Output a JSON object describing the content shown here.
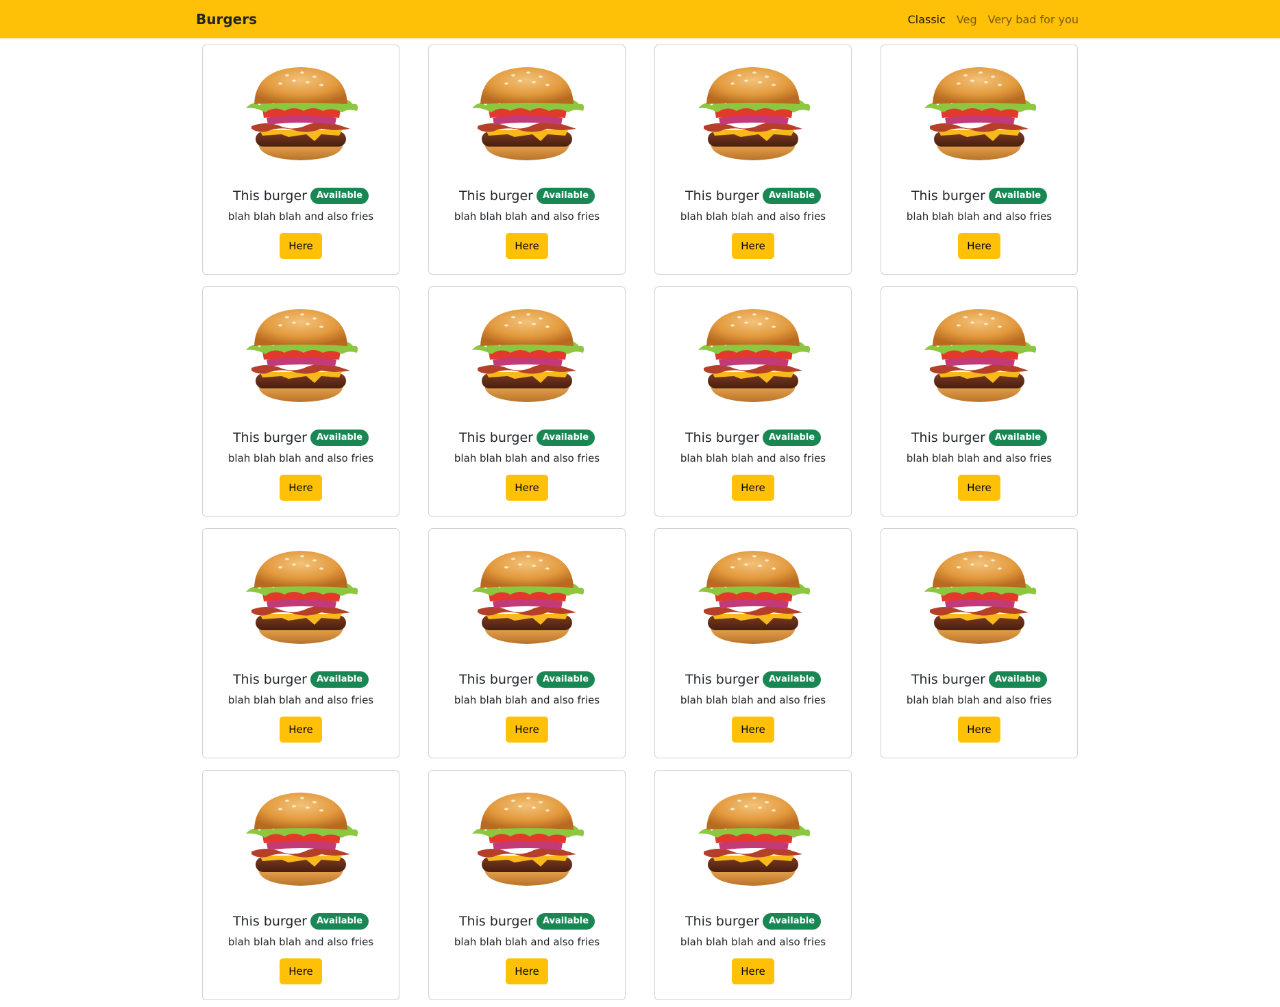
{
  "navbar": {
    "brand": "Burgers",
    "links": [
      {
        "label": "Classic",
        "active": true
      },
      {
        "label": "Veg",
        "active": false
      },
      {
        "label": "Very bad for you",
        "active": false
      }
    ]
  },
  "colors": {
    "navbar_bg": "#ffc107",
    "badge_bg": "#198754",
    "button_bg": "#ffc107"
  },
  "cards": [
    {
      "title": "This burger",
      "badge": "Available",
      "text": "blah blah blah and also fries",
      "button": "Here",
      "image": "burger-image"
    },
    {
      "title": "This burger",
      "badge": "Available",
      "text": "blah blah blah and also fries",
      "button": "Here",
      "image": "burger-image"
    },
    {
      "title": "This burger",
      "badge": "Available",
      "text": "blah blah blah and also fries",
      "button": "Here",
      "image": "burger-image"
    },
    {
      "title": "This burger",
      "badge": "Available",
      "text": "blah blah blah and also fries",
      "button": "Here",
      "image": "burger-image"
    },
    {
      "title": "This burger",
      "badge": "Available",
      "text": "blah blah blah and also fries",
      "button": "Here",
      "image": "burger-image"
    },
    {
      "title": "This burger",
      "badge": "Available",
      "text": "blah blah blah and also fries",
      "button": "Here",
      "image": "burger-image"
    },
    {
      "title": "This burger",
      "badge": "Available",
      "text": "blah blah blah and also fries",
      "button": "Here",
      "image": "burger-image"
    },
    {
      "title": "This burger",
      "badge": "Available",
      "text": "blah blah blah and also fries",
      "button": "Here",
      "image": "burger-image"
    },
    {
      "title": "This burger",
      "badge": "Available",
      "text": "blah blah blah and also fries",
      "button": "Here",
      "image": "burger-image"
    },
    {
      "title": "This burger",
      "badge": "Available",
      "text": "blah blah blah and also fries",
      "button": "Here",
      "image": "burger-image"
    },
    {
      "title": "This burger",
      "badge": "Available",
      "text": "blah blah blah and also fries",
      "button": "Here",
      "image": "burger-image"
    },
    {
      "title": "This burger",
      "badge": "Available",
      "text": "blah blah blah and also fries",
      "button": "Here",
      "image": "burger-image"
    },
    {
      "title": "This burger",
      "badge": "Available",
      "text": "blah blah blah and also fries",
      "button": "Here",
      "image": "burger-image"
    },
    {
      "title": "This burger",
      "badge": "Available",
      "text": "blah blah blah and also fries",
      "button": "Here",
      "image": "burger-image"
    },
    {
      "title": "This burger",
      "badge": "Available",
      "text": "blah blah blah and also fries",
      "button": "Here",
      "image": "burger-image"
    }
  ]
}
